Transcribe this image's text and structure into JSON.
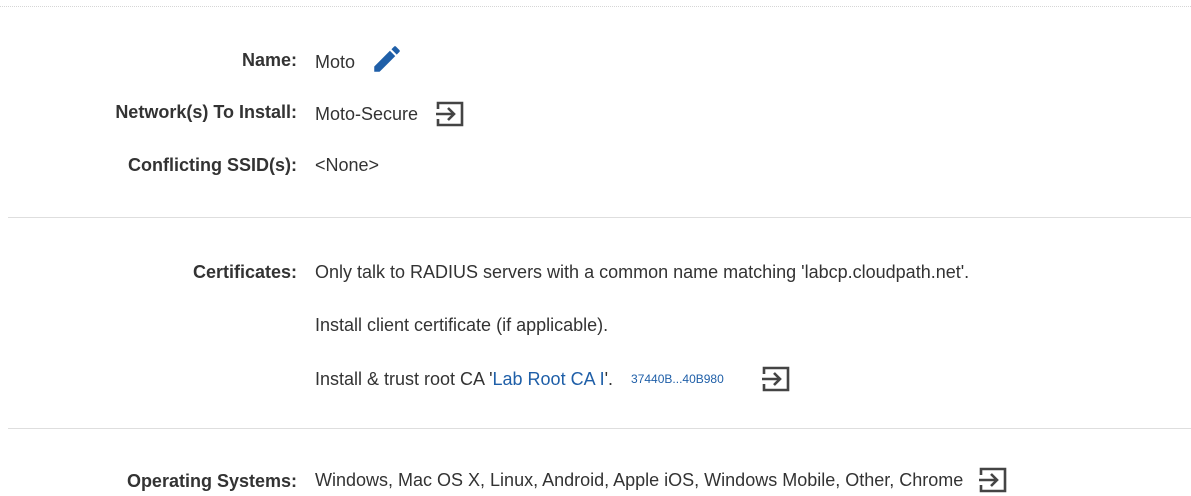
{
  "profile": {
    "name_label": "Name:",
    "name_value": "Moto",
    "networks_label": "Network(s) To Install:",
    "networks_value": "Moto-Secure",
    "conflicting_label": "Conflicting SSID(s):",
    "conflicting_value": "<None>"
  },
  "certificates": {
    "label": "Certificates:",
    "line1": "Only talk to RADIUS servers with a common name matching 'labcp.cloudpath.net'.",
    "line2": "Install client certificate (if applicable).",
    "line3_prefix": "Install & trust root CA '",
    "line3_link": "Lab Root CA I",
    "line3_suffix": "'.",
    "thumbprint": "37440B...40B980"
  },
  "os": {
    "label": "Operating Systems:",
    "value": "Windows, Mac OS X, Linux, Android, Apple iOS, Windows Mobile, Other, Chrome"
  },
  "colors": {
    "accent": "#1f5fa8",
    "text": "#333333",
    "icon": "#444444",
    "divider": "#dedede"
  },
  "icons": {
    "edit": "pencil-icon",
    "goto": "sign-in-arrow-icon"
  }
}
